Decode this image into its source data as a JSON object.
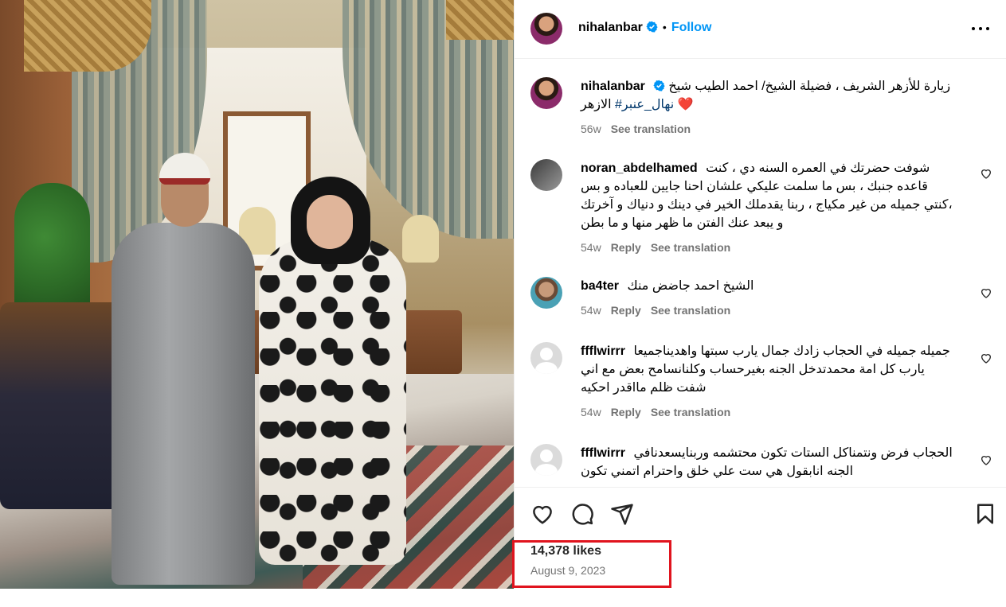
{
  "post": {
    "author": "nihalanbar",
    "follow_label": "Follow",
    "separator": "•",
    "caption": {
      "text": "زيارة للأزهر الشريف ، فضيلة الشيخ/ احمد الطيب شيخ الازهر",
      "hashtag": "#نهال_عنبر",
      "emoji": "❤️",
      "time": "56w",
      "see_translation": "See translation"
    },
    "likes": "14,378 likes",
    "date": "August 9, 2023"
  },
  "comments": [
    {
      "username": "noran_abdelhamed",
      "text": "شوفت حضرتك في العمره السنه دي ، كنت قاعده جنبك ، بس ما سلمت عليكي علشان احنا جايين للعباده و بس ،كنتي جميله من غير مكياج ، ربنا يقدملك الخير في دينك و دنياك و آخرتك و يبعد عنك الفتن ما ظهر منها و ما بطن",
      "time": "54w",
      "reply": "Reply",
      "see_translation": "See translation"
    },
    {
      "username": "ba4ter",
      "text": "الشيخ احمد جاضض منك",
      "time": "54w",
      "reply": "Reply",
      "see_translation": "See translation"
    },
    {
      "username": "ffflwirrr",
      "text": "جميله جميله في الحجاب زادك جمال يارب سبتها واهديناجميعا يارب كل امة محمدتدخل الجنه بغيرحساب وكلنانسامح بعض مع اني شفت ظلم مااقدر احكيه",
      "time": "54w",
      "reply": "Reply",
      "see_translation": "See translation"
    },
    {
      "username": "ffflwirrr",
      "text": "الحجاب فرض ونتمناكل الستات تكون محتشمه وربنايسعدنافي الجنه انابقول هي ست علي خلق واحترام اتمني تكون"
    }
  ],
  "icons": {
    "verified": "verified-badge-icon",
    "more": "more-options-icon",
    "like": "heart-icon",
    "comment": "comment-icon",
    "share": "share-icon",
    "save": "bookmark-icon",
    "comment_like": "heart-small-icon"
  },
  "colors": {
    "accent": "#0095f6",
    "muted": "#737373",
    "hashtag": "#00376b",
    "highlight": "#e0141e"
  }
}
